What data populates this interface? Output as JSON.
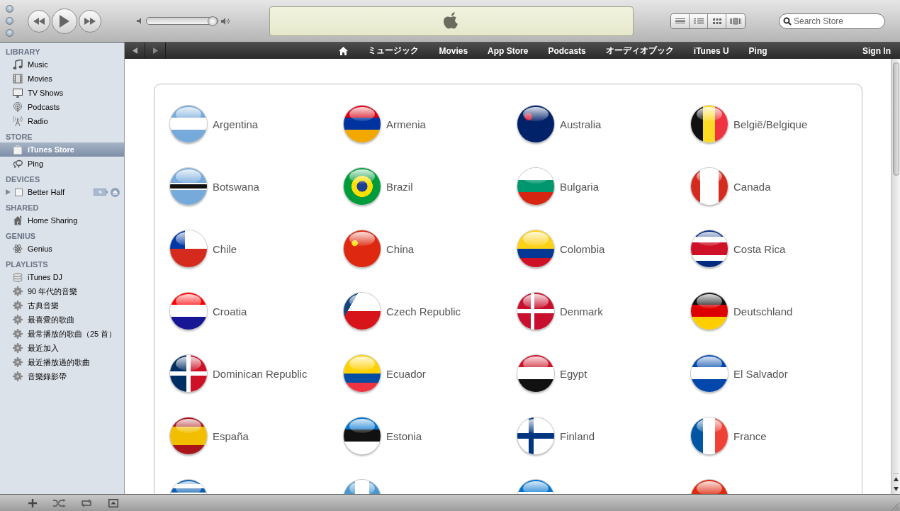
{
  "toolbar": {
    "volume": {
      "level": 0.93
    },
    "search": {
      "placeholder": "Search Store"
    }
  },
  "sidebar": {
    "sections": [
      {
        "title": "LIBRARY",
        "items": [
          {
            "label": "Music",
            "kind": "music",
            "selected": false
          },
          {
            "label": "Movies",
            "kind": "movies",
            "selected": false
          },
          {
            "label": "TV Shows",
            "kind": "tv",
            "selected": false
          },
          {
            "label": "Podcasts",
            "kind": "podcasts",
            "selected": false
          },
          {
            "label": "Radio",
            "kind": "radio",
            "selected": false
          }
        ]
      },
      {
        "title": "STORE",
        "items": [
          {
            "label": "iTunes Store",
            "kind": "store",
            "selected": true
          },
          {
            "label": "Ping",
            "kind": "ping",
            "selected": false
          }
        ]
      },
      {
        "title": "DEVICES",
        "items": [
          {
            "label": "Better Half",
            "kind": "device",
            "selected": false,
            "expanded": false
          }
        ]
      },
      {
        "title": "SHARED",
        "items": [
          {
            "label": "Home Sharing",
            "kind": "home",
            "selected": false
          }
        ]
      },
      {
        "title": "GENIUS",
        "items": [
          {
            "label": "Genius",
            "kind": "genius",
            "selected": false
          }
        ]
      },
      {
        "title": "PLAYLISTS",
        "items": [
          {
            "label": "iTunes DJ",
            "kind": "dj",
            "selected": false
          },
          {
            "label": "90 年代的音樂",
            "kind": "smart",
            "selected": false
          },
          {
            "label": "古典音樂",
            "kind": "smart",
            "selected": false
          },
          {
            "label": "最喜愛的歌曲",
            "kind": "smart",
            "selected": false
          },
          {
            "label": "最常播放的歌曲（25 首）",
            "kind": "smart",
            "selected": false
          },
          {
            "label": "最近加入",
            "kind": "smart",
            "selected": false
          },
          {
            "label": "最近播放過的歌曲",
            "kind": "smart",
            "selected": false
          },
          {
            "label": "音樂錄影帶",
            "kind": "smart",
            "selected": false
          }
        ]
      }
    ]
  },
  "nav": {
    "items": [
      "ミュージック",
      "Movies",
      "App Store",
      "Podcasts",
      "オーディオブック",
      "iTunes U",
      "Ping"
    ],
    "sign_in": "Sign In"
  },
  "countries": [
    {
      "kind": "country",
      "name": "Argentina"
    },
    {
      "kind": "country",
      "name": "Armenia"
    },
    {
      "kind": "country",
      "name": "Australia"
    },
    {
      "kind": "country",
      "name": "België/Belgique"
    },
    {
      "kind": "country",
      "name": "Botswana"
    },
    {
      "kind": "country",
      "name": "Brazil"
    },
    {
      "kind": "country",
      "name": "Bulgaria"
    },
    {
      "kind": "country",
      "name": "Canada"
    },
    {
      "kind": "country",
      "name": "Chile"
    },
    {
      "kind": "country",
      "name": "China"
    },
    {
      "kind": "country",
      "name": "Colombia"
    },
    {
      "kind": "country",
      "name": "Costa Rica"
    },
    {
      "kind": "country",
      "name": "Croatia"
    },
    {
      "kind": "country",
      "name": "Czech Republic"
    },
    {
      "kind": "country",
      "name": "Denmark"
    },
    {
      "kind": "country",
      "name": "Deutschland"
    },
    {
      "kind": "country",
      "name": "Dominican Republic"
    },
    {
      "kind": "country",
      "name": "Ecuador"
    },
    {
      "kind": "country",
      "name": "Egypt"
    },
    {
      "kind": "country",
      "name": "El Salvador"
    },
    {
      "kind": "country",
      "name": "España"
    },
    {
      "kind": "country",
      "name": "Estonia"
    },
    {
      "kind": "country",
      "name": "Finland"
    },
    {
      "kind": "country",
      "name": "France"
    },
    {
      "kind": "cut"
    },
    {
      "kind": "cut"
    },
    {
      "kind": "cut"
    },
    {
      "kind": "cut"
    }
  ]
}
